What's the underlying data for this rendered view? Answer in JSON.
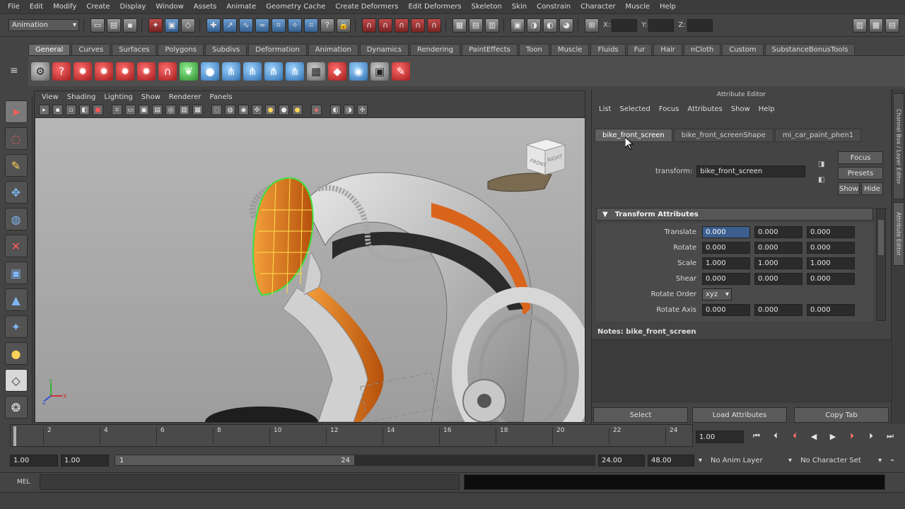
{
  "menubar": [
    "File",
    "Edit",
    "Modify",
    "Create",
    "Display",
    "Window",
    "Assets",
    "Animate",
    "Geometry Cache",
    "Create Deformers",
    "Edit Deformers",
    "Skeleton",
    "Skin",
    "Constrain",
    "Character",
    "Muscle",
    "Help"
  ],
  "statusline": {
    "mode": "Animation",
    "coord_labels": [
      "X:",
      "Y:",
      "Z:"
    ]
  },
  "shelf_tabs": [
    "General",
    "Curves",
    "Surfaces",
    "Polygons",
    "Subdivs",
    "Deformation",
    "Animation",
    "Dynamics",
    "Rendering",
    "PaintEffects",
    "Toon",
    "Muscle",
    "Fluids",
    "Fur",
    "Hair",
    "nCloth",
    "Custom",
    "SubstanceBonusTools"
  ],
  "active_shelf_tab": "General",
  "viewport": {
    "menu": [
      "View",
      "Shading",
      "Lighting",
      "Show",
      "Renderer",
      "Panels"
    ],
    "viewcube_labels": [
      "FRONT",
      "RIGHT"
    ],
    "axis": {
      "x": "X",
      "y": "Y",
      "z": "Z"
    }
  },
  "attribute_editor": {
    "title": "Attribute Editor",
    "menu": [
      "List",
      "Selected",
      "Focus",
      "Attributes",
      "Show",
      "Help"
    ],
    "tabs": [
      "bike_front_screen",
      "bike_front_screenShape",
      "mi_car_paint_phen1"
    ],
    "active_tab": "bike_front_screen",
    "transform_label": "transform:",
    "transform_value": "bike_front_screen",
    "buttons": {
      "focus": "Focus",
      "presets": "Presets",
      "show": "Show",
      "hide": "Hide"
    },
    "section_title": "Transform Attributes",
    "rows": [
      {
        "label": "Translate",
        "values": [
          "0.000",
          "0.000",
          "0.000"
        ]
      },
      {
        "label": "Rotate",
        "values": [
          "0.000",
          "0.000",
          "0.000"
        ]
      },
      {
        "label": "Scale",
        "values": [
          "1.000",
          "1.000",
          "1.000"
        ]
      },
      {
        "label": "Shear",
        "values": [
          "0.000",
          "0.000",
          "0.000"
        ]
      }
    ],
    "rotate_order_label": "Rotate Order",
    "rotate_order_value": "xyz",
    "rotate_axis_label": "Rotate Axis",
    "rotate_axis_values": [
      "0.000",
      "0.000",
      "0.000"
    ],
    "notes_label": "Notes: bike_front_screen",
    "bottom_buttons": [
      "Select",
      "Load Attributes",
      "Copy Tab"
    ]
  },
  "side_tabs": [
    "Channel Box / Layer Editor",
    "Attribute Editor"
  ],
  "timeline": {
    "ticks": [
      "2",
      "4",
      "6",
      "8",
      "10",
      "12",
      "14",
      "16",
      "18",
      "20",
      "22",
      "24"
    ],
    "current_frame": "1.00"
  },
  "range": {
    "start": "1.00",
    "playback_start": "1.00",
    "slider_start": "1",
    "slider_end": "24",
    "playback_end": "24.00",
    "end": "48.00",
    "anim_layer": "No Anim Layer",
    "character_set": "No Character Set"
  },
  "cmdline": {
    "label": "MEL"
  }
}
